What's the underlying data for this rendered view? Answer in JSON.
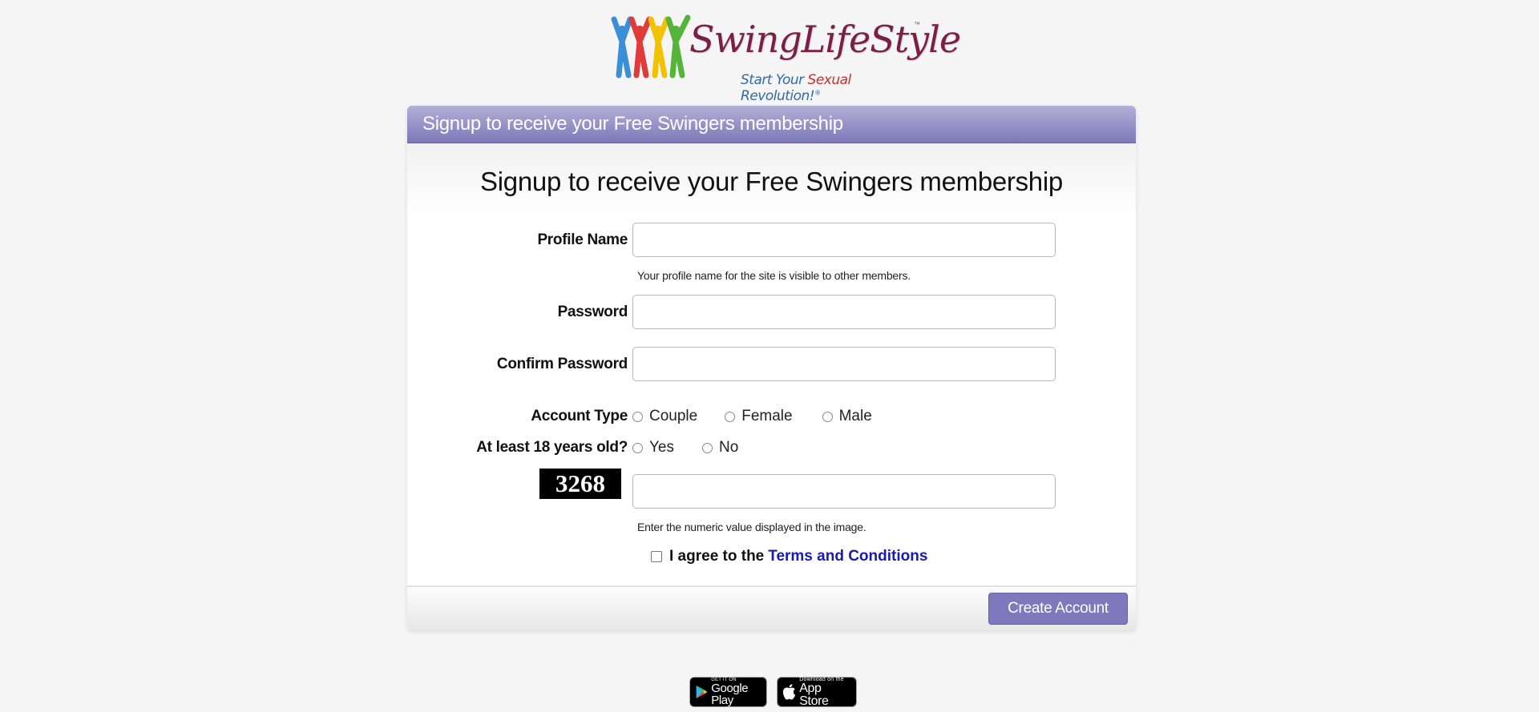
{
  "logo": {
    "title": "SwingLifeStyle",
    "trademark": "™",
    "tagline_start": "Start Your ",
    "tagline_highlight": "Sexual",
    "tagline_end": " Revolution!",
    "tagline_mark": "®",
    "figure_colors": [
      "#3a8fd8",
      "#e03a3a",
      "#f2c200",
      "#55b43a"
    ]
  },
  "panel": {
    "header_title": "Signup to receive your Free Swingers membership",
    "form_title": "Signup to receive your Free Swingers membership"
  },
  "form": {
    "profile_name": {
      "label": "Profile Name",
      "value": "",
      "hint": "Your profile name for the site is visible to other members."
    },
    "password": {
      "label": "Password",
      "value": ""
    },
    "confirm_password": {
      "label": "Confirm Password",
      "value": ""
    },
    "account_type": {
      "label": "Account Type",
      "options": [
        "Couple",
        "Female",
        "Male"
      ],
      "selected": null
    },
    "age_check": {
      "label": "At least 18 years old?",
      "options": [
        "Yes",
        "No"
      ],
      "selected": null
    },
    "captcha": {
      "image_text": "3268",
      "value": "",
      "hint": "Enter the numeric value displayed in the image."
    },
    "agree": {
      "checked": false,
      "text": "I agree to the",
      "link_text": "Terms and Conditions"
    }
  },
  "footer": {
    "create_button": "Create Account"
  },
  "colors": {
    "accent": "#7d79bc",
    "link": "#1a1ab0",
    "header_top": "#b3b0d8",
    "header_bottom": "#7c78b8"
  },
  "badges": {
    "google_play": {
      "small": "GET IT ON",
      "big": "Google Play"
    },
    "app_store": {
      "small": "Download on the",
      "big": "App Store"
    }
  }
}
